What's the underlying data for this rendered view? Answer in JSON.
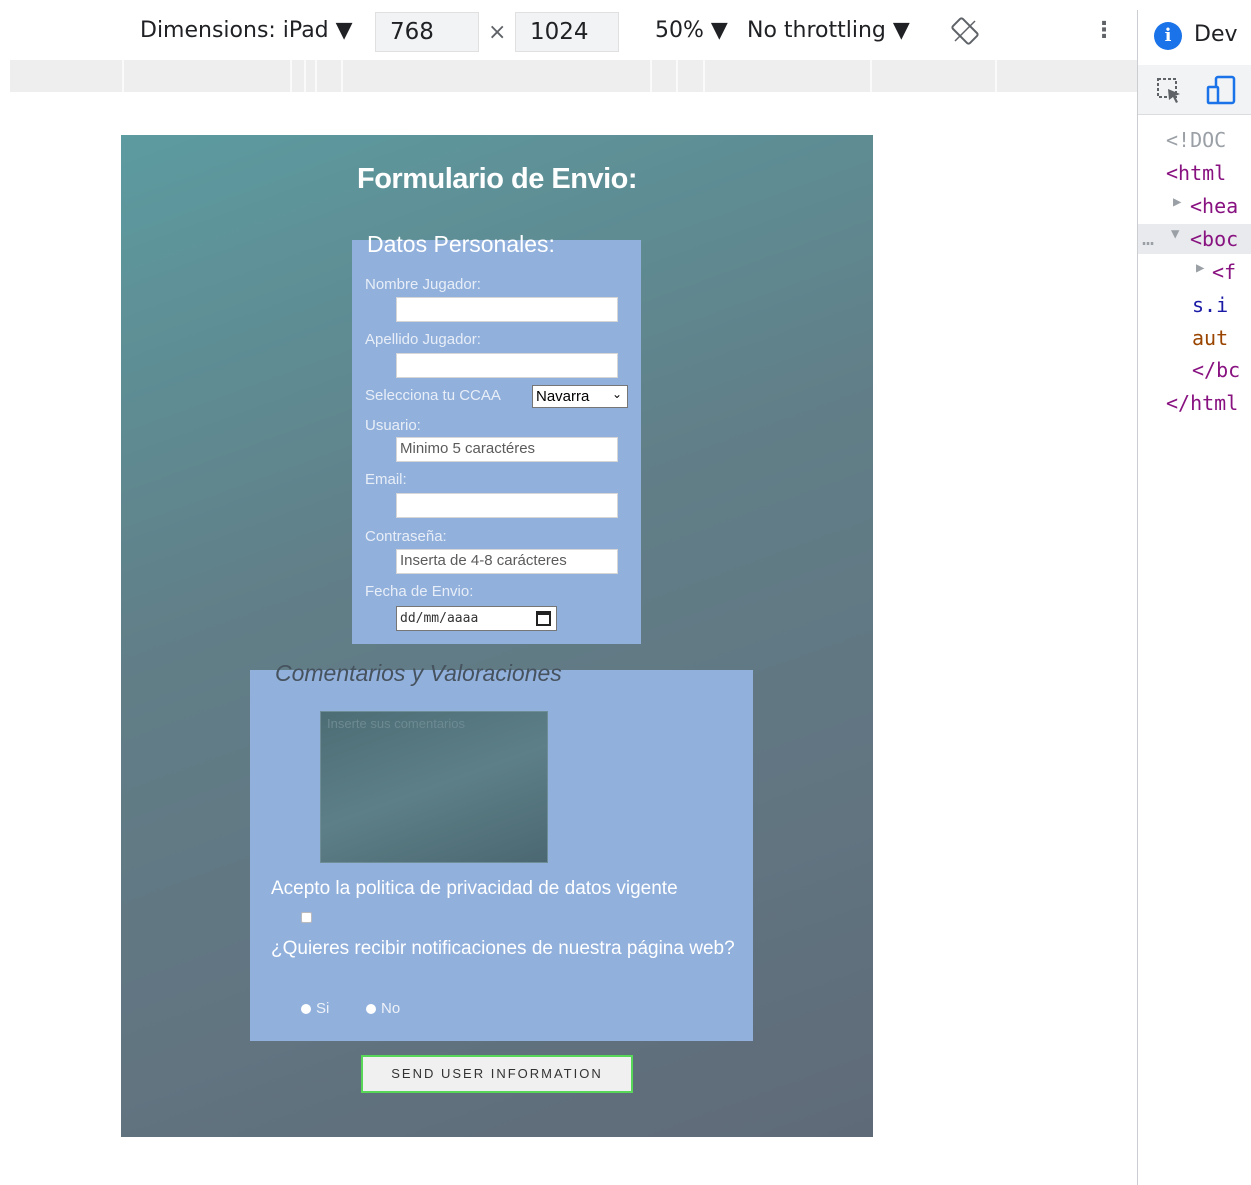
{
  "device_toolbar": {
    "dimensions_label": "Dimensions: iPad ▼",
    "width": "768",
    "times": "×",
    "height": "1024",
    "zoom": "50% ▼",
    "throttling": "No throttling ▼",
    "more": "⋮"
  },
  "devtools": {
    "title": "Dev",
    "info_glyph": "i",
    "code_lines": [
      {
        "text": "<!DOC",
        "class": "gray"
      },
      {
        "text": "<html",
        "class": "tag"
      },
      {
        "text": "<hea",
        "class": "tag"
      },
      {
        "text": "<boc",
        "class": "tag"
      },
      {
        "text": "<f",
        "class": "tag"
      },
      {
        "text": "s.i",
        "class": "blue"
      },
      {
        "text": "aut",
        "class": "attr"
      },
      {
        "text": "</bc",
        "class": "tag"
      },
      {
        "text": "</html",
        "class": "tag"
      }
    ],
    "ellipsis": "…"
  },
  "form": {
    "title": "Formulario de Envio:",
    "personal": {
      "legend": "Datos Personales:",
      "nombre_label": "Nombre Jugador:",
      "apellido_label": "Apellido Jugador:",
      "ccaa_label": "Selecciona tu CCAA",
      "ccaa_value": "Navarra",
      "usuario_label": "Usuario:",
      "usuario_placeholder": "Minimo 5 caractéres",
      "email_label": "Email:",
      "password_label": "Contraseña:",
      "password_placeholder": "Inserta de 4-8 carácteres",
      "fecha_label": "Fecha de Envio:",
      "fecha_placeholder": "dd/mm/aaaa"
    },
    "comments": {
      "legend": "Comentarios y Valoraciones",
      "textarea_placeholder": "Inserte sus comentarios",
      "privacy_text": "Acepto la politica de privacidad de datos vigente",
      "notify_text": "¿Quieres recibir notificaciones de nuestra página web?",
      "radio_yes": "Si",
      "radio_no": "No"
    },
    "submit_label": "SEND USER INFORMATION"
  }
}
